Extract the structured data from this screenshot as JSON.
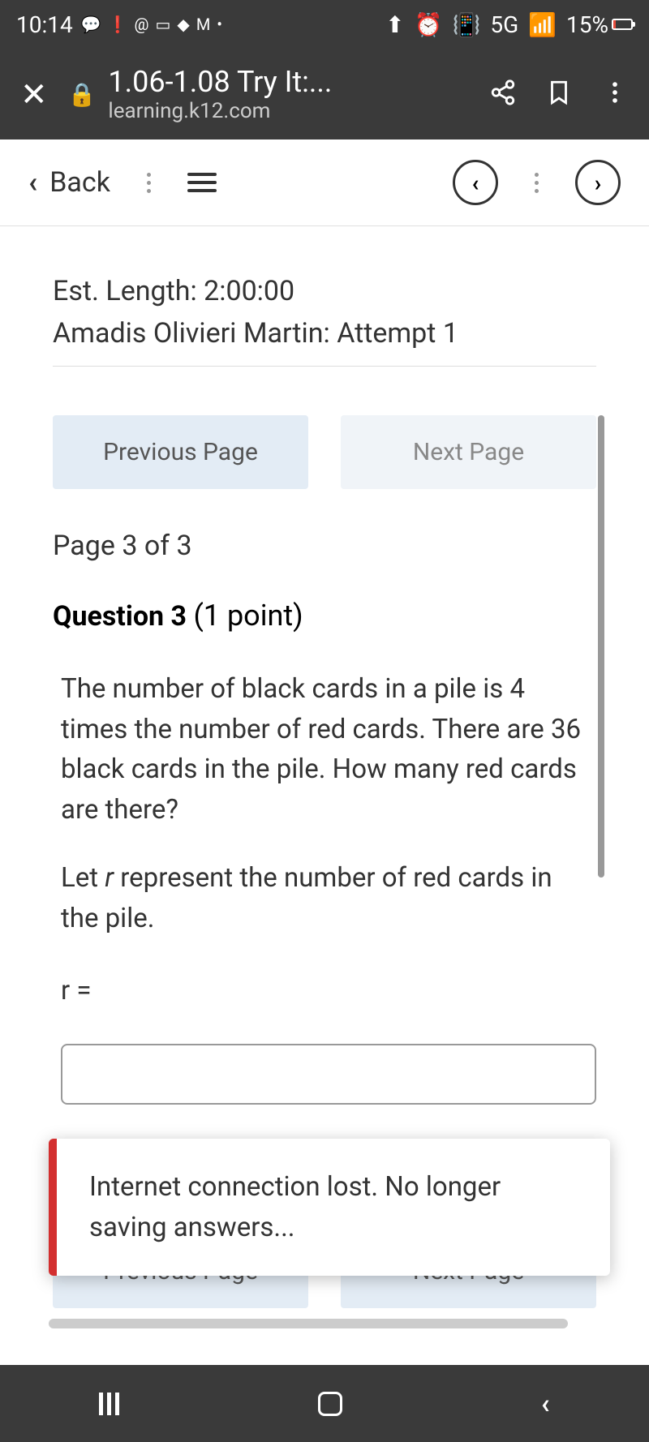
{
  "status_bar": {
    "time": "10:14",
    "network": "5G",
    "signal_icon": "signal-icon",
    "battery_percent": "15%"
  },
  "browser": {
    "title": "1.06-1.08 Try It:...",
    "domain": "learning.k12.com"
  },
  "toolbar": {
    "back_label": "Back"
  },
  "content": {
    "est_length": "Est. Length: 2:00:00",
    "student_attempt": "Amadis Olivieri Martin: Attempt 1",
    "prev_page": "Previous Page",
    "next_page": "Next Page",
    "page_indicator": "Page 3 of 3",
    "question_number": "Question 3",
    "question_points": "(1 point)",
    "question_text": "The number of black cards in a pile is 4 times the number of red cards. There are 36 black cards in the pile. How many red cards are there?",
    "let_prefix": "Let ",
    "let_var": "r",
    "let_suffix": " represent the number of red cards in the pile.",
    "equals": "r =",
    "bg_prev": "Previous Page",
    "bg_next": "Next Page"
  },
  "toast": {
    "message": "Internet connection lost. No longer saving answers..."
  }
}
